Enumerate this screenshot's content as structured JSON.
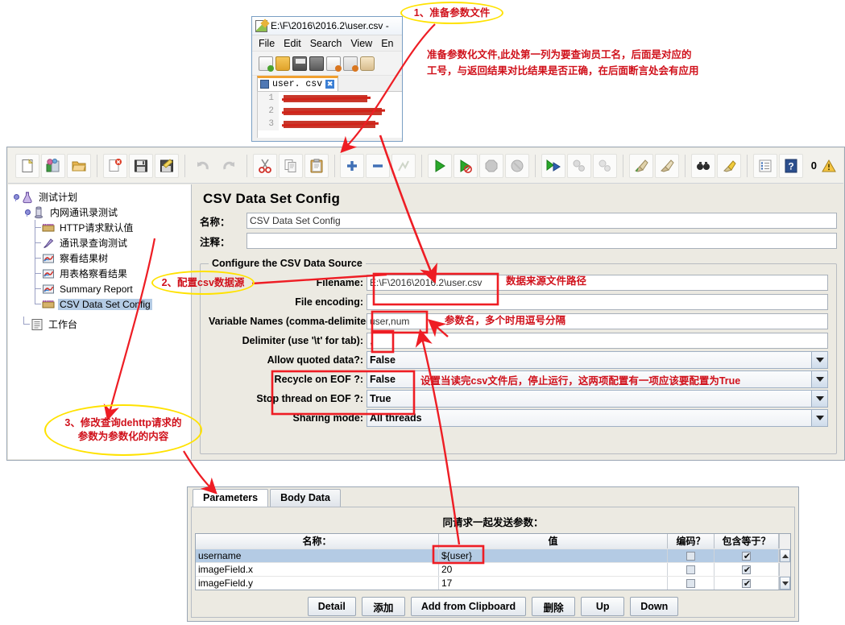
{
  "notepad": {
    "title": "E:\\F\\2016\\2016.2\\user.csv -",
    "menus": [
      "File",
      "Edit",
      "Search",
      "View",
      "En"
    ],
    "tab_label": "user. csv",
    "tab_close": "✖",
    "line_numbers": [
      "1",
      "2",
      "3"
    ]
  },
  "jmeter": {
    "toolbar": {
      "error_count": "0"
    },
    "tree": [
      {
        "label": "测试计划",
        "icon": "test-plan-icon",
        "depth": 0,
        "selected": false
      },
      {
        "label": "内网通讯录测试",
        "icon": "thread-group-icon",
        "depth": 1,
        "selected": false
      },
      {
        "label": "HTTP请求默认值",
        "icon": "config-icon",
        "depth": 2,
        "selected": false
      },
      {
        "label": "通讯录查询测试",
        "icon": "sampler-icon",
        "depth": 2,
        "selected": false
      },
      {
        "label": "察看结果树",
        "icon": "listener-icon",
        "depth": 2,
        "selected": false
      },
      {
        "label": "用表格察看结果",
        "icon": "listener-icon",
        "depth": 2,
        "selected": false
      },
      {
        "label": "Summary Report",
        "icon": "listener-icon",
        "depth": 2,
        "selected": false
      },
      {
        "label": "CSV Data Set Config",
        "icon": "config-icon",
        "depth": 2,
        "selected": true
      },
      {
        "label": "工作台",
        "icon": "workbench-icon",
        "depth": 0,
        "selected": false
      }
    ],
    "config": {
      "panel_title": "CSV Data Set Config",
      "name_label": "名称：",
      "name_value": "CSV Data Set Config",
      "comment_label": "注释：",
      "comment_value": "",
      "fieldset_legend": "Configure the CSV Data Source",
      "rows": [
        {
          "label": "Filename:",
          "value": "E:\\F\\2016\\2016.2\\user.csv",
          "type": "text"
        },
        {
          "label": "File encoding:",
          "value": "",
          "type": "text"
        },
        {
          "label": "Variable Names (comma-delimited):",
          "value": "user,num",
          "type": "text"
        },
        {
          "label": "Delimiter (use '\\t' for tab):",
          "value": ",",
          "type": "text"
        },
        {
          "label": "Allow quoted data?:",
          "value": "False",
          "type": "combo"
        },
        {
          "label": "Recycle on EOF ?:",
          "value": "False",
          "type": "combo"
        },
        {
          "label": "Stop thread on EOF ?:",
          "value": "True",
          "type": "combo"
        },
        {
          "label": "Sharing mode:",
          "value": "All threads",
          "type": "combo"
        }
      ]
    }
  },
  "parameters_panel": {
    "tabs": [
      {
        "label": "Parameters",
        "active": true
      },
      {
        "label": "Body Data",
        "active": false
      }
    ],
    "send_with_request_label": "同请求一起发送参数：",
    "columns": [
      "名称：",
      "值",
      "编码？",
      "包含等于？"
    ],
    "rows": [
      {
        "name": "username",
        "value": "${user}",
        "encode": false,
        "include_equals": true,
        "selected": true
      },
      {
        "name": "imageField.x",
        "value": "20",
        "encode": false,
        "include_equals": true,
        "selected": false
      },
      {
        "name": "imageField.y",
        "value": "17",
        "encode": false,
        "include_equals": true,
        "selected": false
      }
    ],
    "buttons": [
      "Detail",
      "添加",
      "Add from Clipboard",
      "删除",
      "Up",
      "Down"
    ]
  },
  "annotations": {
    "step1_title": "1、准备参数文件",
    "step1_desc_line1": "准备参数化文件,此处第一列为要查询员工名，后面是对应的",
    "step1_desc_line2": "工号，与返回结果对比结果是否正确，在后面断言处会有应用",
    "step2_title": "2、配置csv数据源",
    "step3_line1": "3、修改查询dehttp请求的",
    "step3_line2": "参数为参数化的内容",
    "filename_note": "数据来源文件路径",
    "varnames_note": "参数名，多个时用逗号分隔",
    "eof_note": "设置当读完csv文件后，停止运行，这两项配置有一项应该要配置为True",
    "accent_red": "#ee1d24",
    "accent_yellow": "#ffe200"
  }
}
